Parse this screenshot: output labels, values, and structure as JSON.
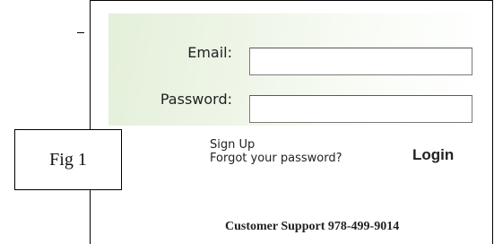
{
  "login": {
    "email_label": "Email:",
    "email_value": "",
    "password_label": "Password:",
    "password_value": ""
  },
  "links": {
    "sign_up": "Sign Up",
    "forgot_password": "Forgot your password?"
  },
  "login_button": "Login",
  "support_text": "Customer Support 978-499-9014",
  "figure_label": "Fig 1"
}
